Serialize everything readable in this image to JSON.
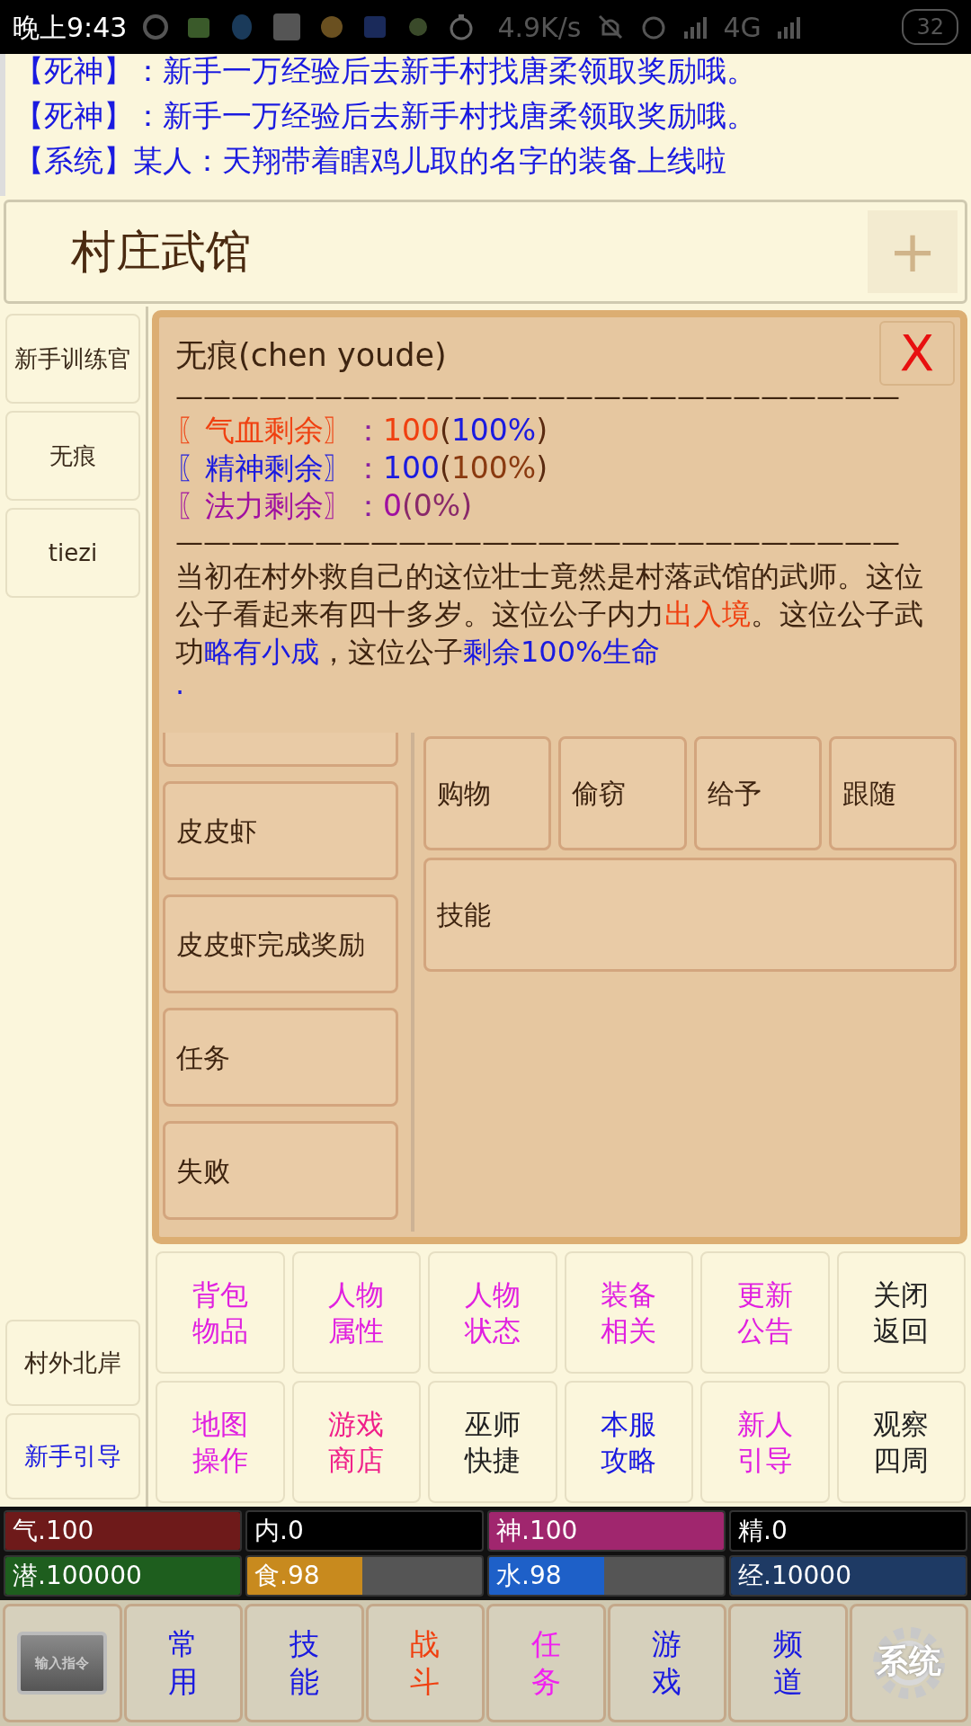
{
  "status_bar": {
    "time": "晚上9:43",
    "speed": "4.9K/s",
    "network": "4G",
    "battery": "32"
  },
  "chat": [
    {
      "speaker": "【死神】",
      "text": "：新手一万经验后去新手村找唐柔领取奖励哦。"
    },
    {
      "speaker": "【死神】",
      "text": "：新手一万经验后去新手村找唐柔领取奖励哦。"
    },
    {
      "speaker": "【系统】",
      "text": "某人：天翔带着瞎鸡儿取的名字的装备上线啦"
    }
  ],
  "header": {
    "title": "村庄武馆",
    "action": "+"
  },
  "sidebar": {
    "items": [
      {
        "label": "新手训练官",
        "color": "#3a2a1a"
      },
      {
        "label": "无痕",
        "color": "#3a2a1a"
      },
      {
        "label": "tiezi",
        "color": "#3a2a1a"
      }
    ],
    "bottom_items": [
      {
        "label": "村外北岸",
        "color": "#3a2a1a"
      },
      {
        "label": "新手引导",
        "color": "#1a1ae0"
      }
    ]
  },
  "popup": {
    "title": "无痕(chen youde)",
    "close": "X",
    "divider": "——————————————————————————",
    "stats": [
      {
        "segments": [
          {
            "text": "〖气血剩余〗",
            "color": "#f04010"
          },
          {
            "text": "：",
            "color": "#8a20a0"
          },
          {
            "text": "100",
            "color": "#f04010"
          },
          {
            "text": "(",
            "color": "#5a2a10"
          },
          {
            "text": "100%",
            "color": "#1a1ae0"
          },
          {
            "text": ")",
            "color": "#5a2a10"
          }
        ]
      },
      {
        "segments": [
          {
            "text": "〖精神剩余〗",
            "color": "#1a1ae0"
          },
          {
            "text": "：",
            "color": "#8a20a0"
          },
          {
            "text": "100",
            "color": "#1a1ae0"
          },
          {
            "text": "(",
            "color": "#5a2a10"
          },
          {
            "text": "100%",
            "color": "#8a3a10"
          },
          {
            "text": ")",
            "color": "#5a2a10"
          }
        ]
      },
      {
        "segments": [
          {
            "text": "〖法力剩余〗",
            "color": "#a010a0"
          },
          {
            "text": "：",
            "color": "#8a20a0"
          },
          {
            "text": "0",
            "color": "#a010a0"
          },
          {
            "text": "(0%)",
            "color": "#8a2a6a"
          }
        ]
      }
    ],
    "divider_2": "——————————————————————————",
    "description": [
      {
        "text": "当初在村外救自己的这位壮士竟然是村落武馆的武师。这位公子看起来有四十多岁。这位公子内力",
        "color": "#3e2410"
      },
      {
        "text": "出入境",
        "color": "#f04010"
      },
      {
        "text": "。这位公子武功",
        "color": "#3e2410"
      },
      {
        "text": "略有小成",
        "color": "#1a1ae0"
      },
      {
        "text": "，这位公子",
        "color": "#3e2410"
      },
      {
        "text": "剩余100%生命",
        "color": "#1a1ae0"
      }
    ],
    "end_mark": "."
  },
  "task_list": [
    {
      "label": "皮皮虾"
    },
    {
      "label": "皮皮虾完成奖励"
    },
    {
      "label": "任务"
    },
    {
      "label": "失败"
    }
  ],
  "actions": [
    {
      "label": "购物",
      "wide": false
    },
    {
      "label": "偷窃",
      "wide": false
    },
    {
      "label": "给予",
      "wide": false
    },
    {
      "label": "跟随",
      "wide": false
    },
    {
      "label": "技能",
      "wide": true
    }
  ],
  "commands": [
    {
      "lines": [
        "背包",
        "物品"
      ],
      "color": "#e020e0"
    },
    {
      "lines": [
        "人物",
        "属性"
      ],
      "color": "#e020e0"
    },
    {
      "lines": [
        "人物",
        "状态"
      ],
      "color": "#e020e0"
    },
    {
      "lines": [
        "装备",
        "相关"
      ],
      "color": "#e020e0"
    },
    {
      "lines": [
        "更新",
        "公告"
      ],
      "color": "#e020e0"
    },
    {
      "lines": [
        "关闭",
        "返回"
      ],
      "color": "#222222"
    },
    {
      "lines": [
        "地图",
        "操作"
      ],
      "color": "#e020e0"
    },
    {
      "lines": [
        "游戏",
        "商店"
      ],
      "color": "#f0208a"
    },
    {
      "lines": [
        "巫师",
        "快捷"
      ],
      "color": "#222222"
    },
    {
      "lines": [
        "本服",
        "攻略"
      ],
      "color": "#1a1ae0"
    },
    {
      "lines": [
        "新人",
        "引导"
      ],
      "color": "#e020e0"
    },
    {
      "lines": [
        "观察",
        "四周"
      ],
      "color": "#222222"
    }
  ],
  "meters": [
    {
      "label": "气.100",
      "color": "#6e1a1a",
      "level": 1
    },
    {
      "label": "内.0",
      "color": "#000000"
    },
    {
      "label": "神.100",
      "color": "#a0266e",
      "level": 1
    },
    {
      "label": "精.0",
      "color": "#000000"
    },
    {
      "label": "潜.100000",
      "color": "#1e5e1e",
      "level": 1
    },
    {
      "label": "食.98",
      "color": "#c88a1e",
      "level": 0.49
    },
    {
      "label": "水.98",
      "color": "#1e60c8",
      "level": 0.49
    },
    {
      "label": "经.10000",
      "color": "#1e3a64",
      "level": 1
    }
  ],
  "nav": [
    {
      "kind": "plaque",
      "label": "输入指令"
    },
    {
      "kind": "text",
      "lines": [
        "常",
        "用"
      ],
      "color": "#1a1ae0"
    },
    {
      "kind": "text",
      "lines": [
        "技",
        "能"
      ],
      "color": "#1a1ae0"
    },
    {
      "kind": "text",
      "lines": [
        "战",
        "斗"
      ],
      "color": "#f04010"
    },
    {
      "kind": "text",
      "lines": [
        "任",
        "务"
      ],
      "color": "#f020f0"
    },
    {
      "kind": "text",
      "lines": [
        "游",
        "戏"
      ],
      "color": "#1a1ae0"
    },
    {
      "kind": "text",
      "lines": [
        "频",
        "道"
      ],
      "color": "#1a1ae0"
    },
    {
      "kind": "gear",
      "label": "系统"
    }
  ]
}
